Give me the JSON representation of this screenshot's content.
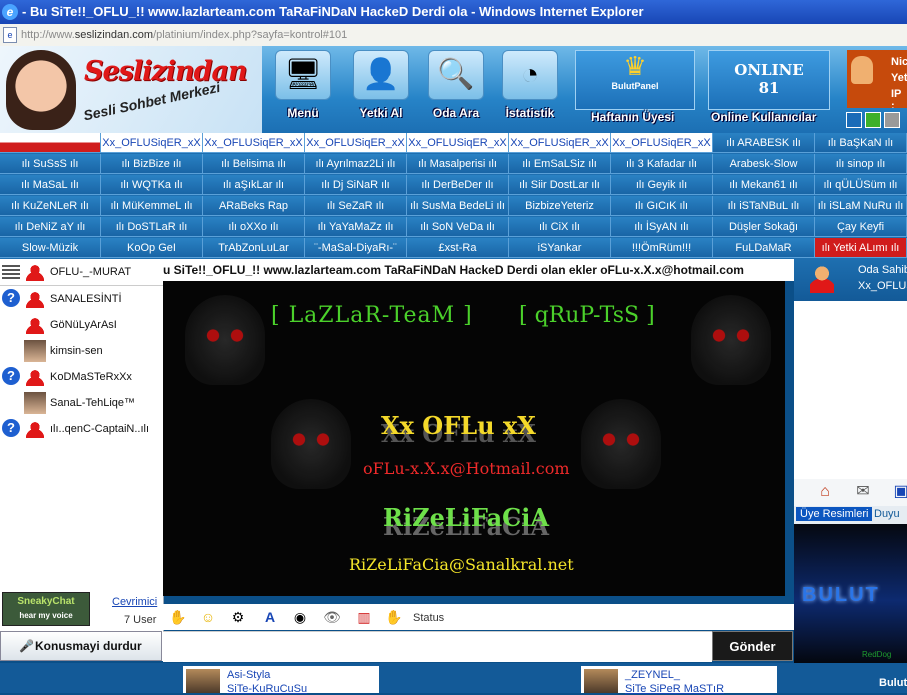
{
  "window": {
    "title": "- Bu SiTe!!_OFLU_!! www.lazlarteam.com TaRaFiNDaN HackeD Derdi ola - Windows Internet Explorer"
  },
  "address": {
    "prefix": "http://www.",
    "domain": "seslizindan.com",
    "path": "/platinium/index.php?sayfa=kontrol#101"
  },
  "header": {
    "logo_text": "Seslizindan",
    "logo_subtitle": "Sesli Sohbet Merkezi",
    "buttons": [
      {
        "label": "Menü",
        "icon": "monitor-icon"
      },
      {
        "label": "Yetki Al",
        "icon": "add-user-icon"
      },
      {
        "label": "Oda Ara",
        "icon": "search-icon"
      },
      {
        "label": "İstatistik",
        "icon": "pie-chart-icon"
      }
    ],
    "panel_title": "BulutPanel",
    "panel_label": "Haftanın Üyesi",
    "online_label": "ONLINE",
    "online_count": "81",
    "online_sub": "Online Kullanıcılar",
    "user_lines": [
      "Nic",
      "Yet",
      "IP :"
    ],
    "window_squares": [
      "#1a6cb8",
      "#3db02a",
      "#9a9a9a"
    ]
  },
  "rooms": [
    [
      "",
      "Xx_OFLUSiqER_xX",
      "Xx_OFLUSiqER_xX",
      "Xx_OFLUSiqER_xX",
      "Xx_OFLUSiqER_xX",
      "Xx_OFLUSiqER_xX",
      "Xx_OFLUSiqER_xX",
      "ılı ARABESK ılı",
      "ılı BaŞKaN ılı"
    ],
    [
      "ılı SuSsS ılı",
      "ılı BizBize ılı",
      "ılı Belisima ılı",
      "ılı Ayrılmaz2Li ılı",
      "ılı Masalperisi ılı",
      "ılı EmSaLSiz ılı",
      "ılı 3 Kafadar ılı",
      "Arabesk-Slow",
      "ılı sinop ılı"
    ],
    [
      "ılı MaSaL ılı",
      "ılı WQTKa ılı",
      "ılı aŞıkLar ılı",
      "ılı Dj SiNaR ılı",
      "ılı DerBeDer ılı",
      "ılı Siir DostLar ılı",
      "ılı Geyik ılı",
      "ılı Mekan61 ılı",
      "ılı qÜLÜSüm ılı"
    ],
    [
      "ılı KuZeNLeR ılı",
      "ılı MüKemmeL ılı",
      "ARaBeks Rap",
      "ılı SeZaR ılı",
      "ılı SusMa BedeLi ılı",
      "BizbizeYeteriz",
      "ılı GıCıK ılı",
      "ılı iSTaNBuL ılı",
      "ılı iSLaM NuRu ılı"
    ],
    [
      "ılı DeNiZ aY ılı",
      "ılı DoSTLaR ılı",
      "ılı oXXo ılı",
      "ılı YaYaMaZz ılı",
      "ılı SoN VeDa ılı",
      "ılı CiX ılı",
      "ılı İSyAN ılı",
      "Düşler Sokağı",
      "Çay Keyfi"
    ],
    [
      "Slow-Müzik",
      "KoOp GeI",
      "TrAbZonLuLar",
      "¨-MaSal-DiyaRı-¨",
      "£xst-Ra",
      "iSYankar",
      "!!!ÖmRüm!!!",
      "FuLDaMaR",
      "ılı Yetki ALımı ılı"
    ]
  ],
  "userlist": {
    "header_name": "OFLU-_-MURAT",
    "users": [
      {
        "name": "SANALESİNTİ",
        "badge": "?",
        "avatar": "user-icon"
      },
      {
        "name": "GöNüLyArAsI",
        "badge": "",
        "avatar": "user-icon"
      },
      {
        "name": "kimsin-sen",
        "badge": "",
        "avatar": "photo"
      },
      {
        "name": "KoDMaSTeRxXx",
        "badge": "?",
        "avatar": "user-icon"
      },
      {
        "name": "SanaL-TehLiqe™",
        "badge": "",
        "avatar": "photo"
      },
      {
        "name": "ılı..qenC-CaptaiN..ılı",
        "badge": "?",
        "avatar": "user-icon"
      }
    ],
    "sneaky_label": "SneakyChat",
    "sneaky_tagline": "hear my voice",
    "online_link": "Cevrimici",
    "user_count": "7 User",
    "stop_button": "Konusmayi durdur"
  },
  "chat": {
    "marquee": "u SiTe!!_OFLU_!! www.lazlarteam.com TaRaFiNDaN HackeD Derdi olan ekler oFLu-x.X.x@hotmail.com",
    "banner": {
      "team": "[ LaZLaR-TeaM ]",
      "group": "[ qRuP-TsS ]",
      "name": "Xx OFLu xX",
      "email": "oFLu-x.X.x@Hotmail.com",
      "name2": "RiZeLiFaCiA",
      "email2": "RiZeLiFaCia@Sanalkral.net"
    },
    "toolbar_icons": [
      "hand-icon",
      "smiley-icon",
      "camera-icon",
      "text-format-icon",
      "webcam-icon",
      "eye-icon",
      "volume-icon",
      "raise-hand-icon"
    ],
    "status_label": "Status",
    "send_button": "Gönder"
  },
  "rightpanel": {
    "room_label": "Oda Sahibi",
    "room_owner": "Xx_OFLUS",
    "tab_active": "Üye Resimleri",
    "tab_inactive": "Duyu",
    "image_text": "BULUT",
    "image_caption": "RedDog"
  },
  "bottom": {
    "cards": [
      {
        "name": "Asi-Styla",
        "sub": "SiTe-KuRuCuSu"
      },
      {
        "name": "_ZEYNEL_",
        "sub": "SiTe SiPeR MaSTıR"
      }
    ],
    "right_label": "Bulut"
  }
}
